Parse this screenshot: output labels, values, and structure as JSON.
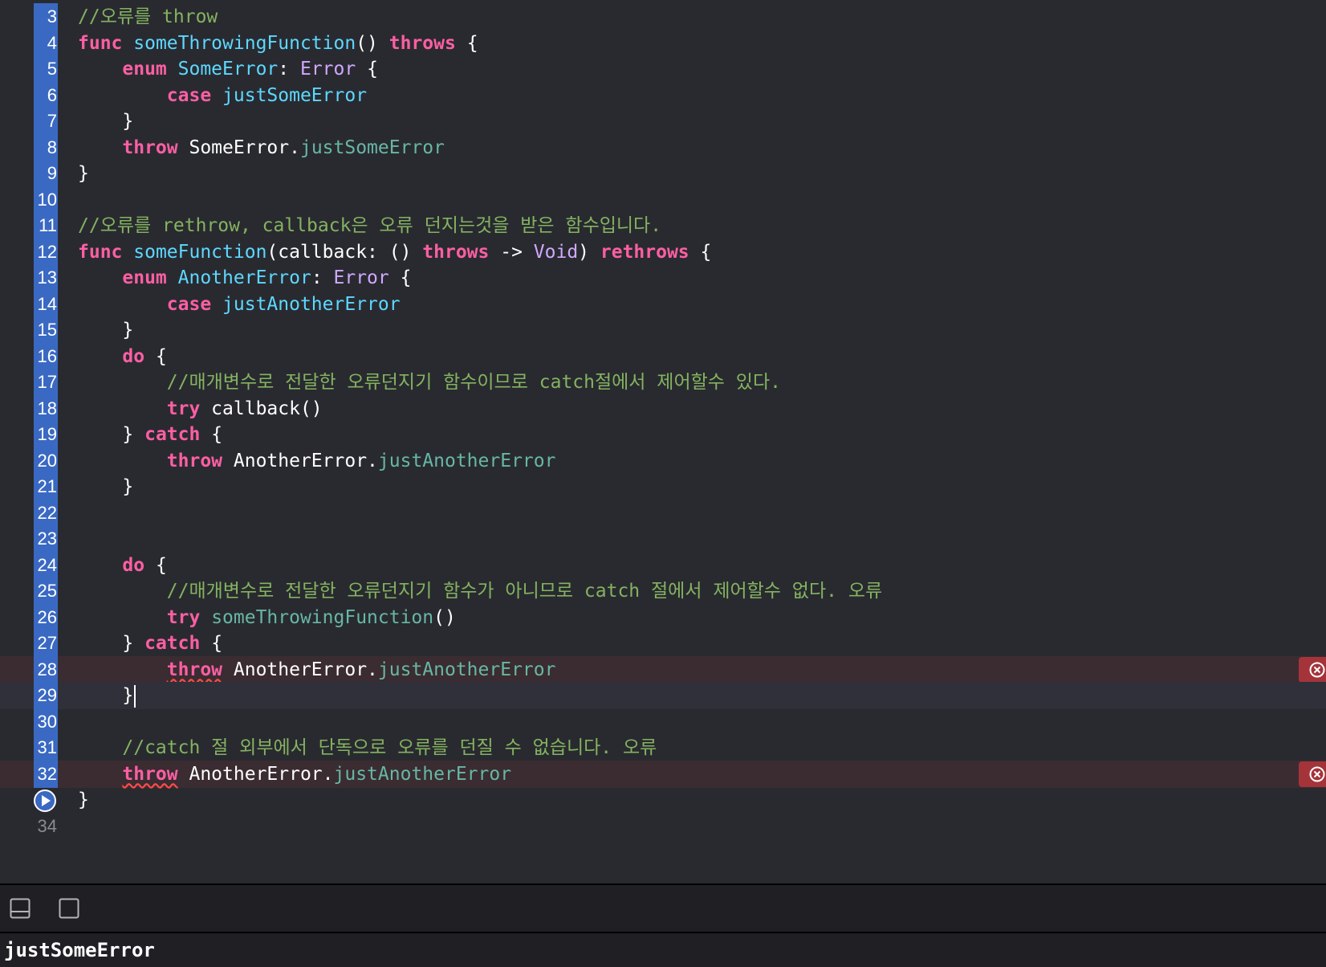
{
  "editor": {
    "lines": [
      {
        "num": "3",
        "tokens": [
          {
            "t": "//오류를 throw",
            "c": "comment"
          }
        ]
      },
      {
        "num": "4",
        "tokens": [
          {
            "t": "func",
            "c": "kw"
          },
          {
            "t": " ",
            "c": "plain"
          },
          {
            "t": "someThrowingFunction",
            "c": "decl"
          },
          {
            "t": "() ",
            "c": "plain"
          },
          {
            "t": "throws",
            "c": "kw"
          },
          {
            "t": " {",
            "c": "plain"
          }
        ]
      },
      {
        "num": "5",
        "tokens": [
          {
            "t": "    ",
            "c": "plain"
          },
          {
            "t": "enum",
            "c": "kw"
          },
          {
            "t": " ",
            "c": "plain"
          },
          {
            "t": "SomeError",
            "c": "decl"
          },
          {
            "t": ": ",
            "c": "plain"
          },
          {
            "t": "Error",
            "c": "type"
          },
          {
            "t": " {",
            "c": "plain"
          }
        ]
      },
      {
        "num": "6",
        "tokens": [
          {
            "t": "        ",
            "c": "plain"
          },
          {
            "t": "case",
            "c": "kw"
          },
          {
            "t": " ",
            "c": "plain"
          },
          {
            "t": "justSomeError",
            "c": "decl"
          }
        ]
      },
      {
        "num": "7",
        "tokens": [
          {
            "t": "    }",
            "c": "plain"
          }
        ]
      },
      {
        "num": "8",
        "tokens": [
          {
            "t": "    ",
            "c": "plain"
          },
          {
            "t": "throw",
            "c": "kw"
          },
          {
            "t": " SomeError.",
            "c": "plain"
          },
          {
            "t": "justSomeError",
            "c": "member"
          }
        ]
      },
      {
        "num": "9",
        "tokens": [
          {
            "t": "}",
            "c": "plain"
          }
        ]
      },
      {
        "num": "10",
        "tokens": []
      },
      {
        "num": "11",
        "tokens": [
          {
            "t": "//오류를 rethrow, callback은 오류 던지는것을 받은 함수입니다.",
            "c": "comment"
          }
        ]
      },
      {
        "num": "12",
        "tokens": [
          {
            "t": "func",
            "c": "kw"
          },
          {
            "t": " ",
            "c": "plain"
          },
          {
            "t": "someFunction",
            "c": "decl"
          },
          {
            "t": "(callback: () ",
            "c": "plain"
          },
          {
            "t": "throws",
            "c": "kw"
          },
          {
            "t": " -> ",
            "c": "plain"
          },
          {
            "t": "Void",
            "c": "type"
          },
          {
            "t": ") ",
            "c": "plain"
          },
          {
            "t": "rethrows",
            "c": "kw"
          },
          {
            "t": " {",
            "c": "plain"
          }
        ]
      },
      {
        "num": "13",
        "tokens": [
          {
            "t": "    ",
            "c": "plain"
          },
          {
            "t": "enum",
            "c": "kw"
          },
          {
            "t": " ",
            "c": "plain"
          },
          {
            "t": "AnotherError",
            "c": "decl"
          },
          {
            "t": ": ",
            "c": "plain"
          },
          {
            "t": "Error",
            "c": "type"
          },
          {
            "t": " {",
            "c": "plain"
          }
        ]
      },
      {
        "num": "14",
        "tokens": [
          {
            "t": "        ",
            "c": "plain"
          },
          {
            "t": "case",
            "c": "kw"
          },
          {
            "t": " ",
            "c": "plain"
          },
          {
            "t": "justAnotherError",
            "c": "decl"
          }
        ]
      },
      {
        "num": "15",
        "tokens": [
          {
            "t": "    }",
            "c": "plain"
          }
        ]
      },
      {
        "num": "16",
        "tokens": [
          {
            "t": "    ",
            "c": "plain"
          },
          {
            "t": "do",
            "c": "kw"
          },
          {
            "t": " {",
            "c": "plain"
          }
        ]
      },
      {
        "num": "17",
        "tokens": [
          {
            "t": "        ",
            "c": "plain"
          },
          {
            "t": "//매개변수로 전달한 오류던지기 함수이므로 catch절에서 제어할수 있다.",
            "c": "comment"
          }
        ]
      },
      {
        "num": "18",
        "tokens": [
          {
            "t": "        ",
            "c": "plain"
          },
          {
            "t": "try",
            "c": "kw"
          },
          {
            "t": " callback()",
            "c": "plain"
          }
        ]
      },
      {
        "num": "19",
        "tokens": [
          {
            "t": "    } ",
            "c": "plain"
          },
          {
            "t": "catch",
            "c": "kw"
          },
          {
            "t": " {",
            "c": "plain"
          }
        ]
      },
      {
        "num": "20",
        "tokens": [
          {
            "t": "        ",
            "c": "plain"
          },
          {
            "t": "throw",
            "c": "kw"
          },
          {
            "t": " AnotherError.",
            "c": "plain"
          },
          {
            "t": "justAnotherError",
            "c": "member"
          }
        ]
      },
      {
        "num": "21",
        "tokens": [
          {
            "t": "    }",
            "c": "plain"
          }
        ]
      },
      {
        "num": "22",
        "tokens": []
      },
      {
        "num": "23",
        "tokens": []
      },
      {
        "num": "24",
        "tokens": [
          {
            "t": "    ",
            "c": "plain"
          },
          {
            "t": "do",
            "c": "kw"
          },
          {
            "t": " {",
            "c": "plain"
          }
        ]
      },
      {
        "num": "25",
        "tokens": [
          {
            "t": "        ",
            "c": "plain"
          },
          {
            "t": "//매개변수로 전달한 오류던지기 함수가 아니므로 catch 절에서 제어할수 없다. 오류",
            "c": "comment"
          }
        ]
      },
      {
        "num": "26",
        "tokens": [
          {
            "t": "        ",
            "c": "plain"
          },
          {
            "t": "try",
            "c": "kw"
          },
          {
            "t": " ",
            "c": "plain"
          },
          {
            "t": "someThrowingFunction",
            "c": "member"
          },
          {
            "t": "()",
            "c": "plain"
          }
        ]
      },
      {
        "num": "27",
        "tokens": [
          {
            "t": "    } ",
            "c": "plain"
          },
          {
            "t": "catch",
            "c": "kw"
          },
          {
            "t": " {",
            "c": "plain"
          }
        ]
      },
      {
        "num": "28",
        "error": true,
        "tokens": [
          {
            "t": "        ",
            "c": "plain"
          },
          {
            "t": "throw",
            "c": "kw wavy"
          },
          {
            "t": " AnotherError.",
            "c": "plain"
          },
          {
            "t": "justAnotherError",
            "c": "member"
          }
        ]
      },
      {
        "num": "29",
        "current": true,
        "caret": true,
        "tokens": [
          {
            "t": "    }",
            "c": "plain"
          }
        ]
      },
      {
        "num": "30",
        "tokens": []
      },
      {
        "num": "31",
        "tokens": [
          {
            "t": "    ",
            "c": "plain"
          },
          {
            "t": "//catch 절 외부에서 단독으로 오류를 던질 수 없습니다. 오류",
            "c": "comment"
          }
        ]
      },
      {
        "num": "32",
        "error": true,
        "tokens": [
          {
            "t": "    ",
            "c": "plain"
          },
          {
            "t": "throw",
            "c": "kw wavy"
          },
          {
            "t": " AnotherError.",
            "c": "plain"
          },
          {
            "t": "justAnotherError",
            "c": "member"
          }
        ]
      },
      {
        "num": "",
        "breakpoint": true,
        "tokens": [
          {
            "t": "}",
            "c": "plain"
          }
        ]
      },
      {
        "num": "34",
        "plain": true,
        "tokens": []
      }
    ]
  },
  "icons": {
    "error": "error-x-circle-icon",
    "run": "run-play-icon",
    "hide_debug": "hide-debug-area-icon",
    "console_toggle": "console-toggle-icon"
  },
  "colors": {
    "background": "#292a30",
    "gutter_highlight": "#3a69c3",
    "keyword": "#fc5fa3",
    "comment": "#84b360",
    "declaration": "#5dd8ff",
    "member": "#67b7a4",
    "type": "#d0a8ff",
    "error_badge": "#a4343a"
  },
  "console": {
    "output": "justSomeError"
  }
}
